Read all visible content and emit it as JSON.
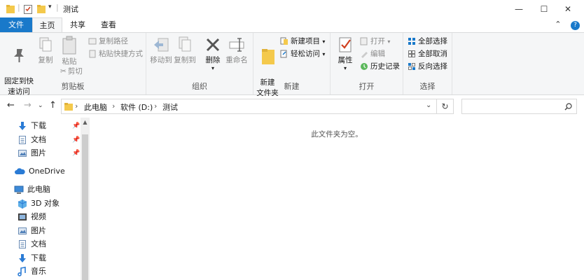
{
  "window": {
    "title": "测试"
  },
  "tabs": {
    "file": "文件",
    "home": "主页",
    "share": "共享",
    "view": "查看"
  },
  "clipboard": {
    "pin_quick_access": "固定到快\n速访问",
    "copy": "复制",
    "paste": "粘贴",
    "copy_path": "复制路径",
    "paste_shortcut": "粘贴快捷方式",
    "cut": "剪切",
    "group_label": "剪贴板"
  },
  "organize": {
    "move_to": "移动到",
    "copy_to": "复制到",
    "delete": "删除",
    "rename": "重命名",
    "group_label": "组织"
  },
  "new": {
    "new_folder": "新建\n文件夹",
    "new_item": "新建项目",
    "easy_access": "轻松访问",
    "group_label": "新建"
  },
  "open": {
    "properties": "属性",
    "open": "打开",
    "edit": "编辑",
    "history": "历史记录",
    "group_label": "打开"
  },
  "select": {
    "select_all": "全部选择",
    "select_none": "全部取消",
    "invert": "反向选择",
    "group_label": "选择"
  },
  "address": {
    "crumbs": [
      "此电脑",
      "软件 (D:)",
      "测试"
    ]
  },
  "navpane": {
    "items": [
      {
        "label": "下载",
        "icon": "download-icon",
        "pinned": true
      },
      {
        "label": "文档",
        "icon": "document-icon",
        "pinned": true
      },
      {
        "label": "图片",
        "icon": "picture-icon",
        "pinned": true
      },
      {
        "label": "OneDrive",
        "icon": "cloud-icon",
        "pinned": false
      },
      {
        "label": "此电脑",
        "icon": "computer-icon",
        "pinned": false
      },
      {
        "label": "3D 对象",
        "icon": "3d-objects-icon",
        "pinned": false
      },
      {
        "label": "视频",
        "icon": "video-icon",
        "pinned": false
      },
      {
        "label": "图片",
        "icon": "picture-icon",
        "pinned": false
      },
      {
        "label": "文档",
        "icon": "document-icon",
        "pinned": false
      },
      {
        "label": "下载",
        "icon": "download-icon",
        "pinned": false
      },
      {
        "label": "音乐",
        "icon": "music-icon",
        "pinned": false
      }
    ]
  },
  "content": {
    "empty_message": "此文件夹为空。"
  },
  "colors": {
    "accent": "#1979ca",
    "folder": "#f4c94c",
    "ribbon_bg": "#f5f6f7"
  }
}
